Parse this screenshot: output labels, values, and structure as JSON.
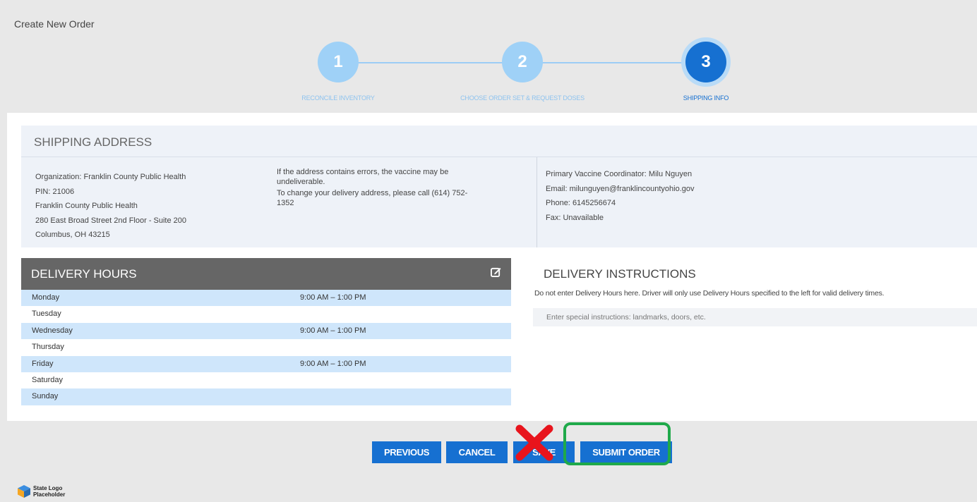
{
  "page": {
    "title": "Create New Order"
  },
  "stepper": {
    "steps": [
      {
        "number": "1",
        "label": "RECONCILE INVENTORY",
        "active": false
      },
      {
        "number": "2",
        "label": "CHOOSE ORDER SET & REQUEST DOSES",
        "active": false
      },
      {
        "number": "3",
        "label": "SHIPPING INFO",
        "active": true
      }
    ]
  },
  "shipping": {
    "header": "SHIPPING ADDRESS",
    "org_label": "Organization:",
    "org_value": "Franklin County Public Health",
    "pin_label": "PIN:",
    "pin_value": "21006",
    "address_line1": "Franklin County Public Health",
    "address_line2": "280 East Broad Street 2nd Floor - Suite 200",
    "address_line3": "Columbus, OH 43215",
    "note_1": "If the address contains errors, the vaccine may be undeliverable.",
    "note_2": "To change your delivery address, please call (614) 752-1352",
    "coordinator_label": "Primary Vaccine Coordinator:",
    "coordinator_value": "Milu Nguyen",
    "email_label": "Email:",
    "email_value": "milunguyen@franklincountyohio.gov",
    "phone_label": "Phone:",
    "phone_value": "6145256674",
    "fax_label": "Fax:",
    "fax_value": "Unavailable"
  },
  "delivery_hours": {
    "title": "DELIVERY HOURS",
    "rows": [
      {
        "day": "Monday",
        "hours": "9:00 AM – 1:00 PM"
      },
      {
        "day": "Tuesday",
        "hours": ""
      },
      {
        "day": "Wednesday",
        "hours": "9:00 AM – 1:00 PM"
      },
      {
        "day": "Thursday",
        "hours": ""
      },
      {
        "day": "Friday",
        "hours": "9:00 AM – 1:00 PM"
      },
      {
        "day": "Saturday",
        "hours": ""
      },
      {
        "day": "Sunday",
        "hours": ""
      }
    ]
  },
  "delivery_instructions": {
    "title": "DELIVERY INSTRUCTIONS",
    "note": "Do not enter Delivery Hours here. Driver will only use Delivery Hours specified to the left for valid delivery times.",
    "placeholder": "Enter special instructions: landmarks, doors, etc."
  },
  "buttons": {
    "previous": "PREVIOUS",
    "cancel": "CANCEL",
    "save": "SAVE",
    "submit": "SUBMIT ORDER"
  },
  "footer": {
    "logo_line1": "State Logo",
    "logo_line2": "Placeholder"
  },
  "colors": {
    "primary": "#1670d1",
    "step_inactive": "#9fd1f7",
    "highlight": "#1fa94a",
    "strike": "#e8141c"
  },
  "icons": {
    "edit": "edit-icon",
    "strike": "red-x-icon",
    "logo": "cube-logo-icon"
  }
}
